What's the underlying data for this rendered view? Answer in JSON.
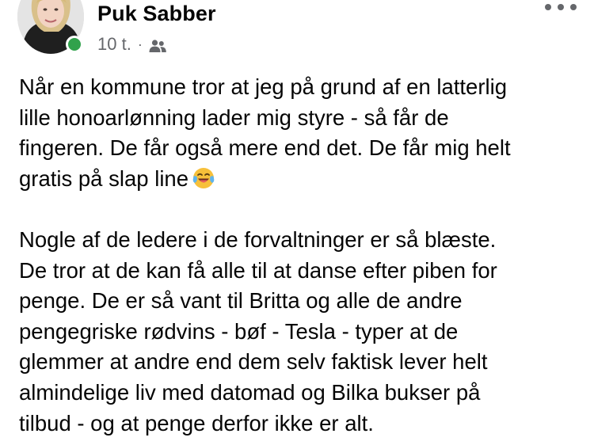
{
  "post": {
    "author": "Puk Sabber",
    "timestamp": "10 t.",
    "separator": "·",
    "audience_icon": "friends-icon",
    "presence_color": "#31a24c",
    "more_icon": "more-options-icon",
    "paragraph1": {
      "lines": [
        "Når en kommune tror at jeg på grund af en latterlig",
        "lille honoarlønning lader mig styre - så får de",
        "fingeren. De får også mere end det. De får mig helt",
        "gratis på slap line"
      ],
      "emoji": "face-with-tears-of-joy"
    },
    "paragraph2": {
      "lines": [
        "Nogle af de ledere i de forvaltninger er så blæste.",
        "De tror at de kan få alle til at danse efter piben for",
        "penge. De er så vant til Britta og alle de andre",
        "pengegriske rødvins - bøf - Tesla - typer at de",
        "glemmer at andre end dem selv faktisk lever helt",
        "almindelige liv med datomad og Bilka bukser på",
        "tilbud - og at penge derfor ikke er alt."
      ]
    }
  }
}
